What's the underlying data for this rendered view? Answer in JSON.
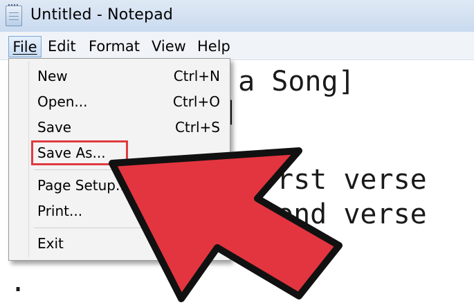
{
  "window": {
    "title": "Untitled - Notepad"
  },
  "menubar": {
    "items": [
      "File",
      "Edit",
      "Format",
      "View",
      "Help"
    ]
  },
  "editor": {
    "lines": [
      " a Song]",
      "]",
      "rst verse",
      "ond verse",
      "..",
      "."
    ]
  },
  "file_menu": {
    "items": [
      {
        "label": "New",
        "shortcut": "Ctrl+N"
      },
      {
        "label": "Open...",
        "shortcut": "Ctrl+O"
      },
      {
        "label": "Save",
        "shortcut": "Ctrl+S"
      },
      {
        "label": "Save As...",
        "shortcut": ""
      },
      {
        "label": "Page Setup...",
        "shortcut": ""
      },
      {
        "label": "Print...",
        "shortcut": ""
      },
      {
        "label": "Exit",
        "shortcut": ""
      }
    ],
    "highlighted_item": "Save As..."
  },
  "colors": {
    "arrow_fill": "#e3353f",
    "arrow_outline": "#111111",
    "highlight_border": "#e03a3f"
  }
}
